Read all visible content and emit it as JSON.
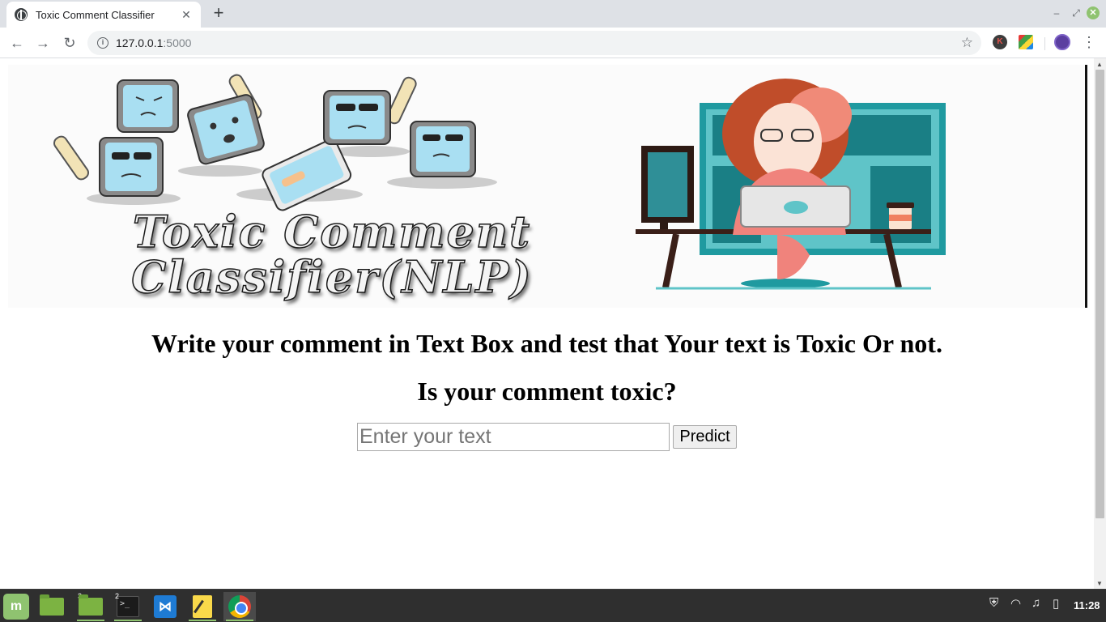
{
  "browser": {
    "tab_title": "Toxic Comment Classifier",
    "tab_close": "✕",
    "new_tab": "+",
    "url_host": "127.0.0.1",
    "url_port": ":5000",
    "ext_k_letter": "K",
    "window_controls": {
      "minimize": "–",
      "restore": "⤢",
      "close": "✕"
    }
  },
  "page": {
    "banner_title_line1": "Toxic Comment",
    "banner_title_line2": "Classifier(NLP)",
    "heading_main": "Write your comment in Text Box and test that Your text is Toxic Or not.",
    "heading_sub": "Is your comment toxic?",
    "input_placeholder": "Enter your text",
    "predict_label": "Predict"
  },
  "taskbar": {
    "files_badge": "3",
    "terminal_badge": "2",
    "clock": "11:28"
  },
  "colors": {
    "accent_green": "#8fc370",
    "chrome_bg": "#dee1e6",
    "teal": "#1f9aa0"
  }
}
